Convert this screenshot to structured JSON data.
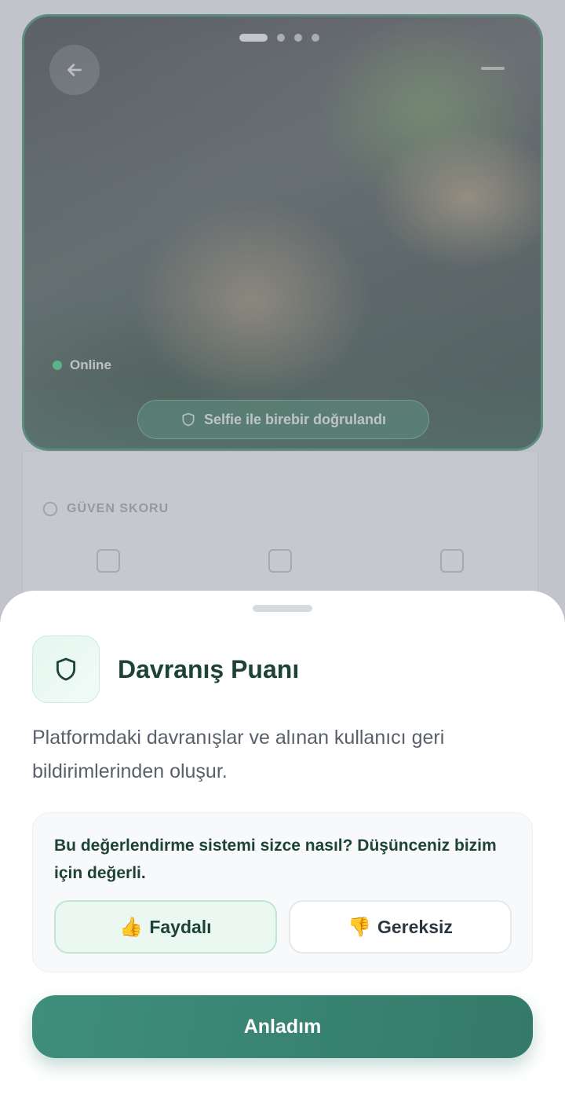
{
  "background": {
    "status_text": "Online",
    "verification_badge": "Selfie ile birebir doğrulandı",
    "trust_section_title": "GÜVEN SKORU",
    "photo_pages": 4,
    "active_photo_page": 1
  },
  "sheet": {
    "title": "Davranış Puanı",
    "description": "Platformdaki davranışlar ve alınan kullanıcı geri bildirimlerinden oluşur.",
    "feedback": {
      "question": "Bu değerlendirme sistemi sizce nasıl? Düşünceniz bizim için değerli.",
      "useful_emoji": "👍",
      "useful_label": "Faydalı",
      "useless_emoji": "👎",
      "useless_label": "Gereksiz"
    },
    "confirm_label": "Anladım"
  },
  "colors": {
    "primary": "#3f8e7c",
    "title_text": "#1d4337",
    "online": "#36d07d",
    "useful_bg": "#eaf8f1"
  },
  "icons": {
    "sheet_icon": "shield-icon",
    "back": "arrow-left-icon",
    "menu": "menu-icon"
  }
}
